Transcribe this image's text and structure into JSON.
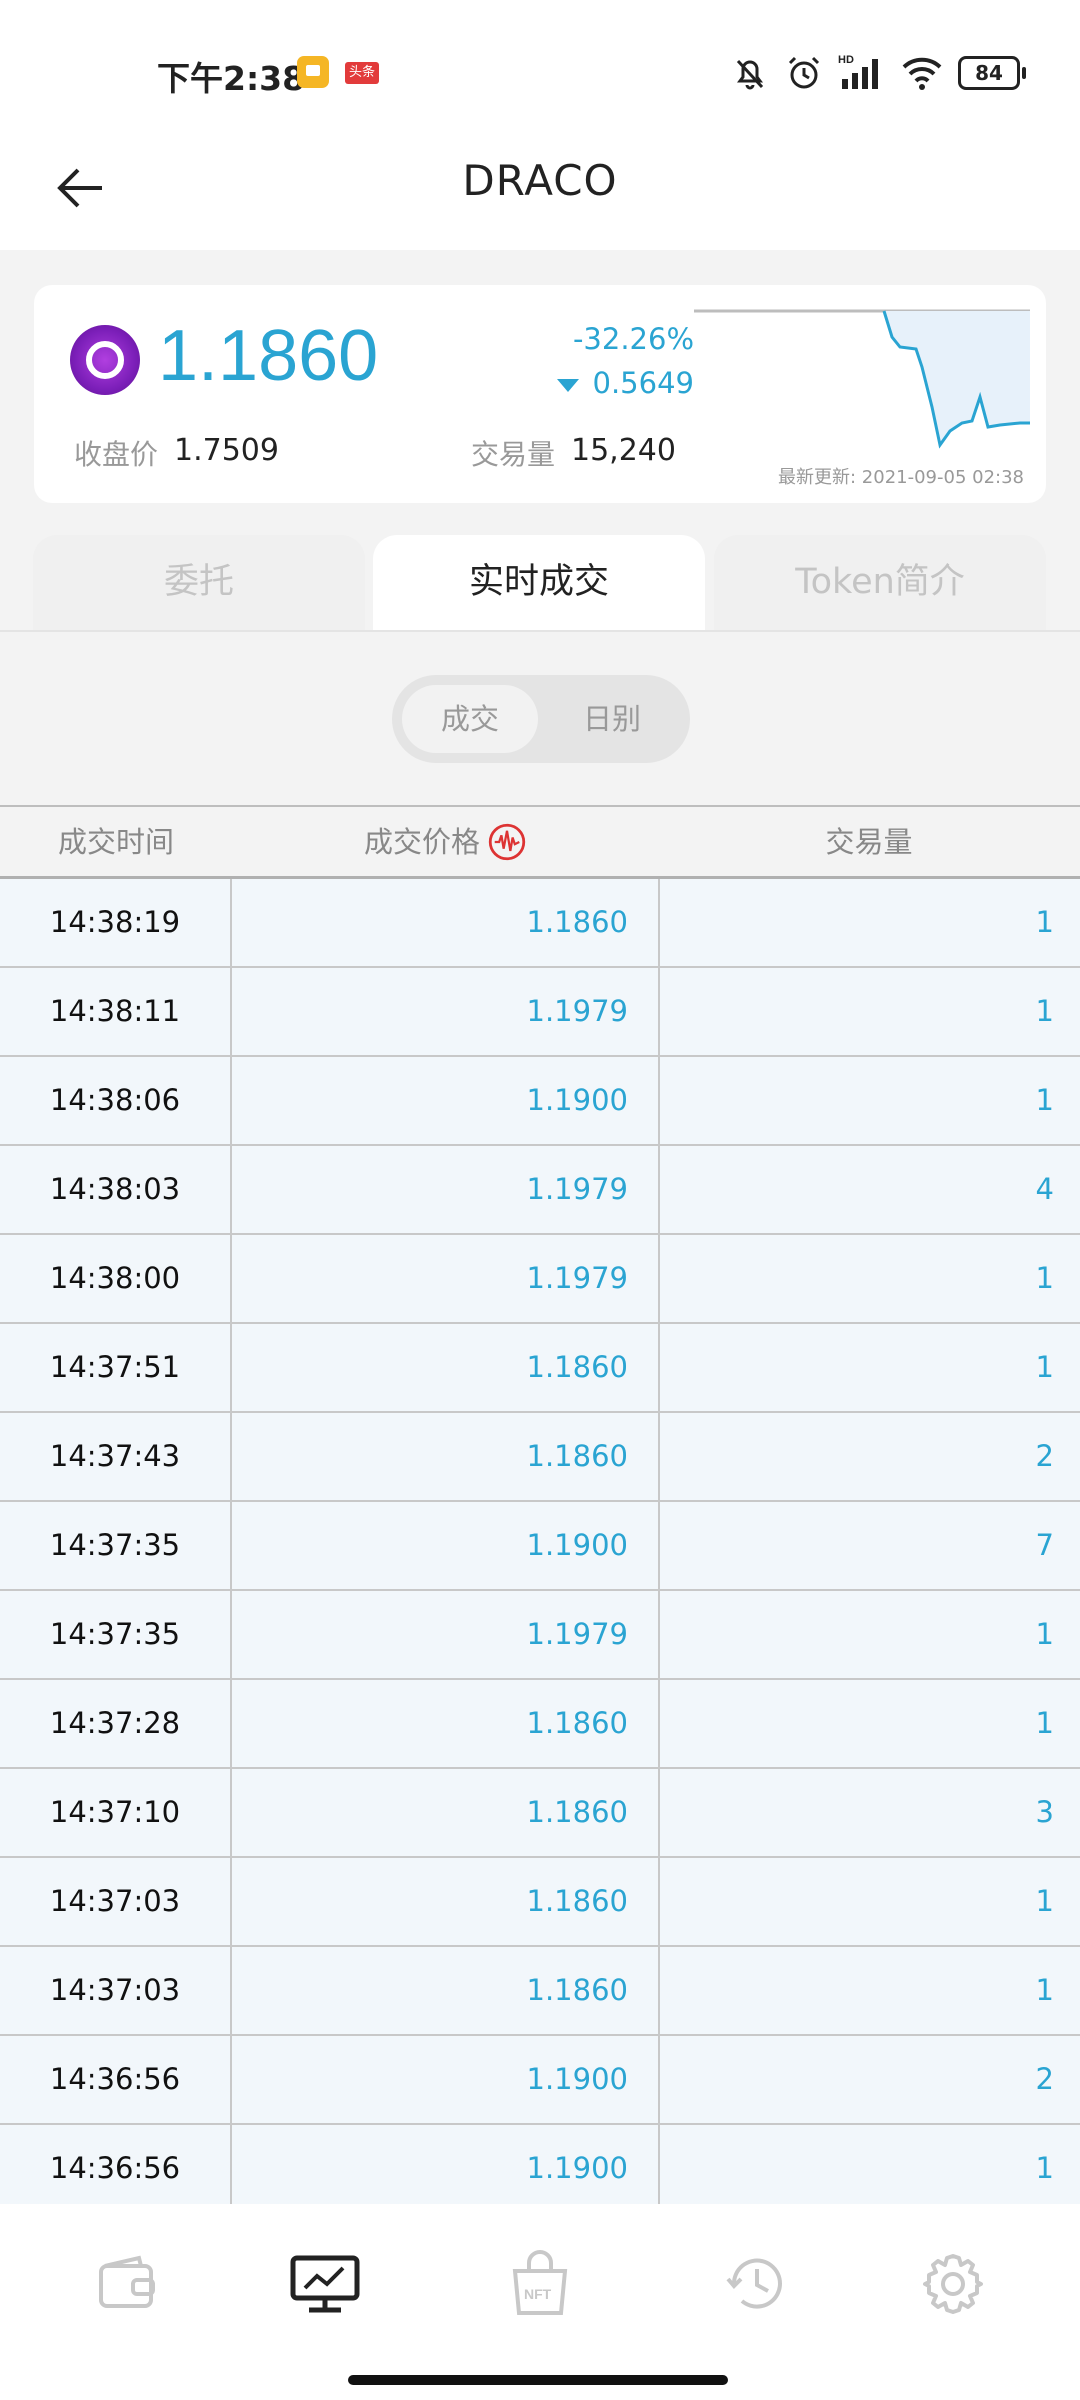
{
  "status_bar": {
    "time": "下午2:38",
    "app_badge": "头条",
    "battery": "84",
    "hd_label": "HD"
  },
  "header": {
    "title": "DRACO"
  },
  "price_card": {
    "price": "1.1860",
    "change_percent": "-32.26%",
    "change_amount": "0.5649",
    "close_label": "收盘价",
    "close_value": "1.7509",
    "volume_label": "交易量",
    "volume_value": "15,240",
    "last_updated": "最新更新: 2021-09-05 02:38",
    "accent_color": "#2aa4d2",
    "trend": "down"
  },
  "tabs": [
    {
      "label": "委托",
      "active": false
    },
    {
      "label": "实时成交",
      "active": true
    },
    {
      "label": "Token简介",
      "active": false
    }
  ],
  "segment": [
    {
      "label": "成交",
      "active": true
    },
    {
      "label": "日别",
      "active": false
    }
  ],
  "table": {
    "headers": [
      "成交时间",
      "成交价格",
      "交易量"
    ],
    "rows": [
      [
        "14:38:19",
        "1.1860",
        "1"
      ],
      [
        "14:38:11",
        "1.1979",
        "1"
      ],
      [
        "14:38:06",
        "1.1900",
        "1"
      ],
      [
        "14:38:03",
        "1.1979",
        "4"
      ],
      [
        "14:38:00",
        "1.1979",
        "1"
      ],
      [
        "14:37:51",
        "1.1860",
        "1"
      ],
      [
        "14:37:43",
        "1.1860",
        "2"
      ],
      [
        "14:37:35",
        "1.1900",
        "7"
      ],
      [
        "14:37:35",
        "1.1979",
        "1"
      ],
      [
        "14:37:28",
        "1.1860",
        "1"
      ],
      [
        "14:37:10",
        "1.1860",
        "3"
      ],
      [
        "14:37:03",
        "1.1860",
        "1"
      ],
      [
        "14:37:03",
        "1.1860",
        "1"
      ],
      [
        "14:36:56",
        "1.1900",
        "2"
      ],
      [
        "14:36:56",
        "1.1900",
        "1"
      ]
    ]
  },
  "bottom_nav": [
    {
      "icon": "wallet-icon",
      "active": false
    },
    {
      "icon": "chart-monitor-icon",
      "active": true
    },
    {
      "icon": "nft-bag-icon",
      "label": "NFT",
      "active": false
    },
    {
      "icon": "history-icon",
      "active": false
    },
    {
      "icon": "settings-gear-icon",
      "active": false
    }
  ]
}
